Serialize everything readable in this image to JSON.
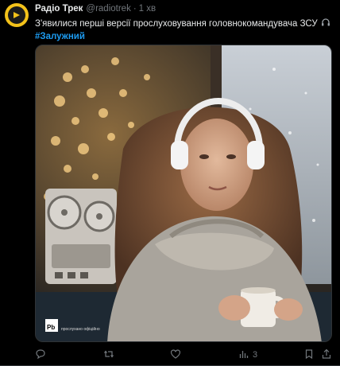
{
  "post": {
    "author_name": "Радіо Трек",
    "author_handle": "@radiotrek",
    "separator": "·",
    "time": "1 хв",
    "text": "З'явилися перші версії прослуховування головнокомандувача ЗСУ",
    "text_icon": "headphones-icon",
    "hashtag": "#Залужний"
  },
  "media": {
    "watermark_logo": "Pb",
    "watermark_text": "прослухано офіційно"
  },
  "actions": {
    "reply_count": "",
    "retweet_count": "",
    "like_count": "",
    "views_count": "3",
    "icons": [
      "reply-icon",
      "retweet-icon",
      "like-icon",
      "views-icon",
      "bookmark-icon",
      "share-icon"
    ]
  },
  "colors": {
    "background": "#000000",
    "text": "#e7e9ea",
    "secondary": "#71767b",
    "accent": "#1d9bf0",
    "avatar": "#f3c21a"
  }
}
